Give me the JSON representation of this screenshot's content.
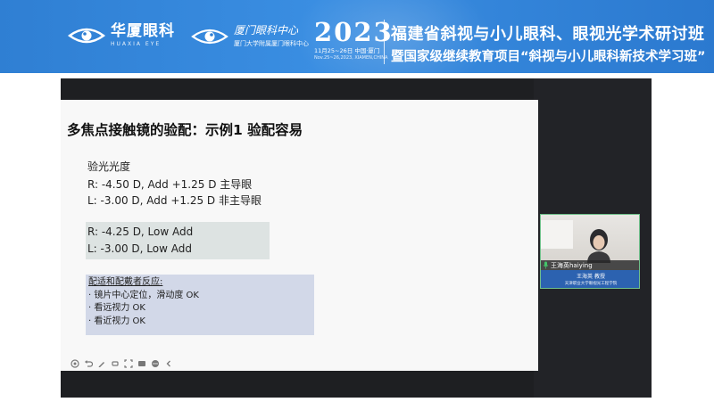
{
  "banner": {
    "logo1_cn": "华厦眼科",
    "logo1_en": "HUAXIA EYE",
    "logo2_cn": "厦门眼科中心",
    "logo2_sub": "厦门大学附属厦门眼科中心",
    "year": "2023",
    "date_cn": "11月25~26日  中国·厦门",
    "date_en": "Nov.25~26,2023, XIAMEN,CHINA",
    "title_line1": "福建省斜视与小儿眼科、眼视光学术研讨班",
    "title_line2": "暨国家级继续教育项目“斜视与小儿眼科新技术学习班”"
  },
  "slide": {
    "title": "多焦点接触镜的验配：示例1 验配容易",
    "rx_heading": "验光光度",
    "rx_lines": [
      "R: -4.50 D, Add +1.25 D    主导眼",
      "L: -3.00 D,  Add +1.25 D    非主导眼"
    ],
    "lens_rows": [
      "R: -4.25 D, Low Add",
      "L: -3.00 D, Low Add"
    ],
    "feedback_heading": "配适和配戴者反应:",
    "feedback_items": [
      "· 镜片中心定位，滑动度 OK",
      "· 看远视力 OK",
      "· 看近视力 OK"
    ]
  },
  "toolbar_icons": [
    "pointer-icon",
    "undo-icon",
    "pen-icon",
    "eraser-icon",
    "zoom-icon",
    "subtitle-icon",
    "more-icon",
    "collapse-icon"
  ],
  "participant": {
    "display_name": "王海英haiying",
    "badge_name": "王海英    教授",
    "badge_org": "天津职业大学眼视光工程学院"
  },
  "colors": {
    "banner_blue": "#2f7fd3",
    "badge_blue": "#2c62b0",
    "tile_border": "#6fbf8a"
  }
}
